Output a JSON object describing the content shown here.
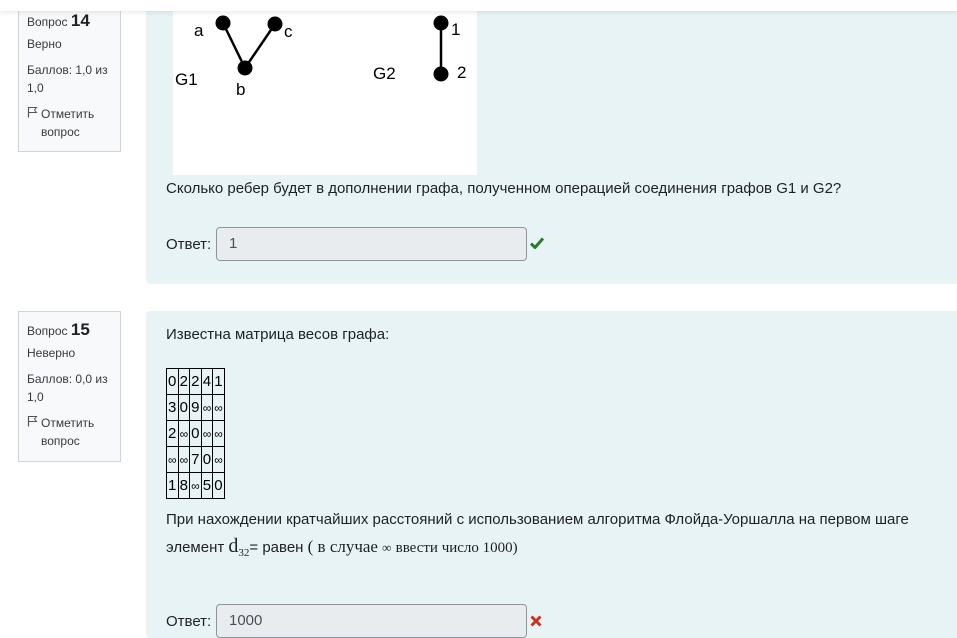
{
  "question14": {
    "label": "Вопрос",
    "number": "14",
    "state": "Верно",
    "grade": "Баллов: 1,0 из 1,0",
    "flag": "Отметить вопрос",
    "graph": {
      "g1_label": "G1",
      "g2_label": "G2",
      "v_a": "a",
      "v_b": "b",
      "v_c": "c",
      "v_1": "1",
      "v_2": "2"
    },
    "text": "Сколько ребер будет в дополнении графа, полученном операцией соединения графов G1 и G2?",
    "answer_label": "Ответ:",
    "answer_value": "1",
    "mark_icon": "check-icon",
    "mark_color": "#2b7a2b"
  },
  "question15": {
    "label": "Вопрос",
    "number": "15",
    "state": "Неверно",
    "grade": "Баллов: 0,0 из 1,0",
    "flag": "Отметить вопрос",
    "intro": "Известна матрица весов графа:",
    "matrix": [
      [
        "0",
        "2",
        "2",
        "4",
        "1"
      ],
      [
        "3",
        "0",
        "9",
        "∞",
        "∞"
      ],
      [
        "2",
        "∞",
        "0",
        "∞",
        "∞"
      ],
      [
        "∞",
        "∞",
        "7",
        "0",
        "∞"
      ],
      [
        "1",
        "8",
        "∞",
        "5",
        "0"
      ]
    ],
    "text_line1": "При нахождении кратчайших расстояний с использованием алгоритма Флойда-Уоршалла на первом шаге",
    "text_line2_prefix": "элемент",
    "element_symbol": "d",
    "element_index": "32",
    "text_line2_equals": "= равен",
    "text_line2_paren_open": "( в случае",
    "text_line2_inf": "∞",
    "text_line2_rest": "ввести число 1000)",
    "answer_label": "Ответ:",
    "answer_value": "1000",
    "mark_icon": "cross-icon",
    "mark_color": "#ca3120"
  },
  "colors": {
    "formulation_bg": "#e7f3f5",
    "info_bg": "#f8f9fa",
    "input_bg": "#e9ecef"
  }
}
